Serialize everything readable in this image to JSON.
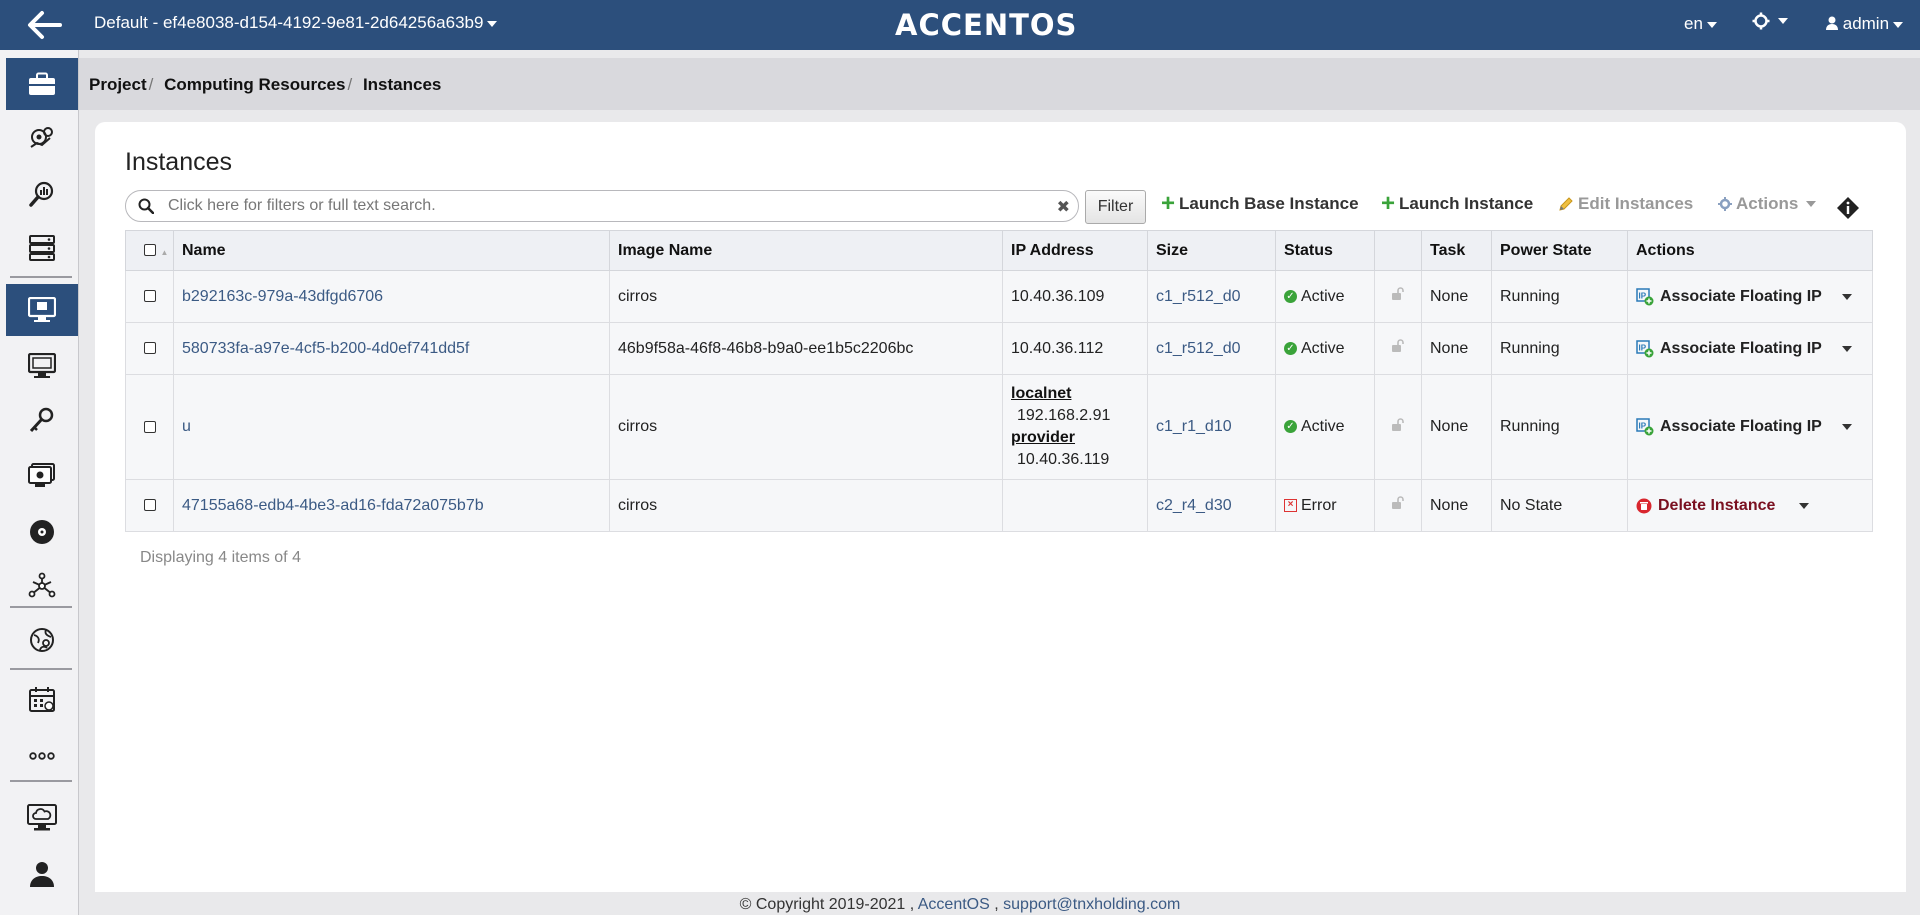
{
  "topbar": {
    "project": "Default - ef4e8038-d154-4192-9e81-2d64256a63b9",
    "logo": "ACCENTOS",
    "language": "en",
    "user": "admin"
  },
  "sidebar": {
    "items": [
      {
        "icon": "briefcase-icon",
        "active": true
      },
      {
        "icon": "gears-chart-icon",
        "active": false
      },
      {
        "icon": "search-chart-icon",
        "active": false
      },
      {
        "icon": "server-rack-icon",
        "active": false
      },
      {
        "icon": "instance-monitor-icon",
        "active": true
      },
      {
        "icon": "monitor-icon",
        "active": false
      },
      {
        "icon": "keys-icon",
        "active": false
      },
      {
        "icon": "snapshot-monitor-icon",
        "active": false
      },
      {
        "icon": "disk-icon",
        "active": false
      },
      {
        "icon": "network-topology-icon",
        "active": false
      },
      {
        "icon": "globe-gear-icon",
        "active": false
      },
      {
        "icon": "calendar-icon",
        "active": false
      },
      {
        "icon": "more-icon",
        "active": false
      },
      {
        "icon": "cloud-monitor-icon",
        "active": false
      },
      {
        "icon": "users-icon",
        "active": false
      }
    ]
  },
  "breadcrumb": [
    "Project",
    "Computing Resources",
    "Instances"
  ],
  "page": {
    "title": "Instances",
    "search_placeholder": "Click here for filters or full text search.",
    "filter_label": "Filter",
    "launch_base": "Launch Base Instance",
    "launch": "Launch Instance",
    "edit": "Edit Instances",
    "actions": "Actions"
  },
  "table": {
    "columns": [
      "Name",
      "Image Name",
      "IP Address",
      "Size",
      "Status",
      "",
      "Task",
      "Power State",
      "Actions"
    ],
    "rows": [
      {
        "name": "b292163c-979a-43dfgd6706",
        "image": "cirros",
        "ip": "10.40.36.109",
        "size": "c1_r512_d0",
        "status": "Active",
        "task": "None",
        "power": "Running",
        "action": "Associate Floating IP"
      },
      {
        "name": "580733fa-a97e-4cf5-b200-4d0ef741dd5f",
        "image": "46b9f58a-46f8-46b8-b9a0-ee1b5c2206bc",
        "ip": "10.40.36.112",
        "size": "c1_r512_d0",
        "status": "Active",
        "task": "None",
        "power": "Running",
        "action": "Associate Floating IP"
      },
      {
        "name": "u",
        "image": "cirros",
        "networks": [
          {
            "name": "localnet",
            "ip": "192.168.2.91"
          },
          {
            "name": "provider",
            "ip": "10.40.36.119"
          }
        ],
        "size": "c1_r1_d10",
        "status": "Active",
        "task": "None",
        "power": "Running",
        "action": "Associate Floating IP"
      },
      {
        "name": "47155a68-edb4-4be3-ad16-fda72a075b7b",
        "image": "cirros",
        "ip": "",
        "size": "c2_r4_d30",
        "status": "Error",
        "task": "None",
        "power": "No State",
        "action": "Delete Instance"
      }
    ],
    "footer": "Displaying 4 items of 4"
  },
  "footer": {
    "copyright": "© Copyright 2019-2021 ,",
    "company": "AccentOS",
    "sep": ",",
    "email": "support@tnxholding.com"
  },
  "colors": {
    "primary": "#2c4f7c",
    "success": "#3aa33a",
    "danger": "#7a1020"
  }
}
